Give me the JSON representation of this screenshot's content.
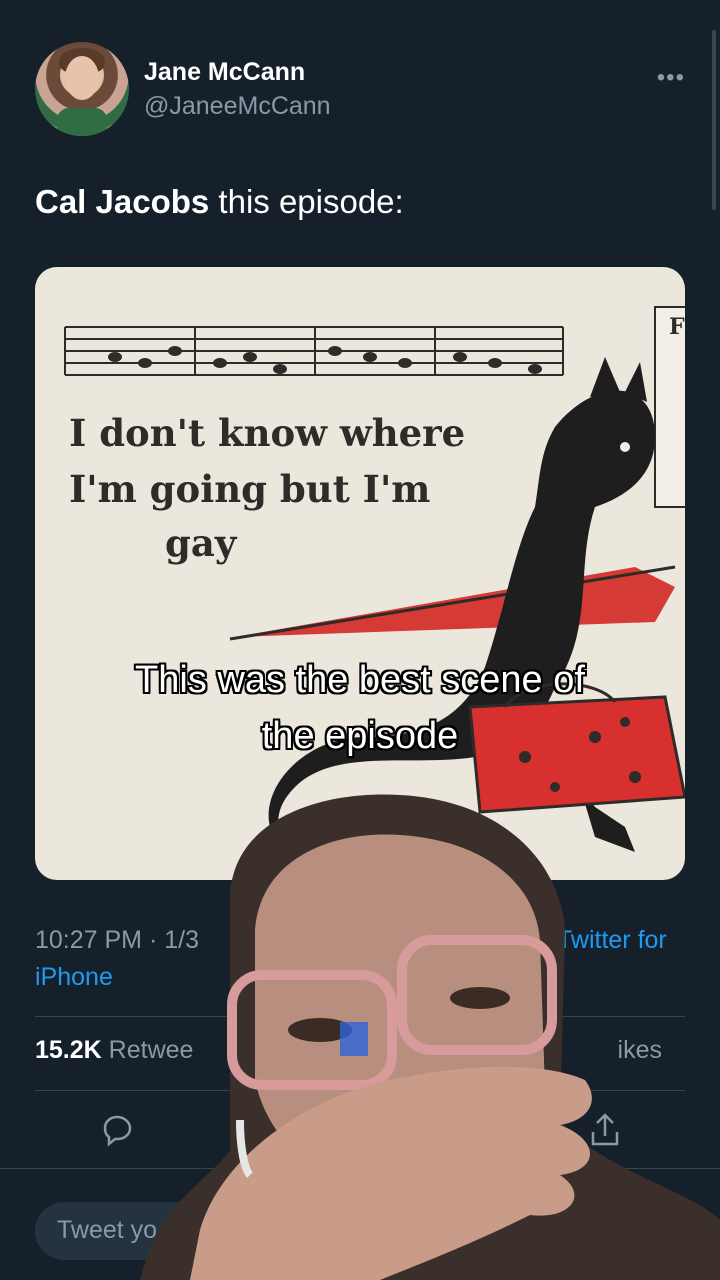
{
  "tweet": {
    "author_name": "Jane McCann",
    "author_handle": "@JaneeMcCann",
    "more_label": "•••",
    "text_bold": "Cal Jacobs",
    "text_rest": " this episode:",
    "meme_line1": "I don't know where",
    "meme_line2": "I'm going but I'm",
    "meme_line3": "gay",
    "meme_corner": "F",
    "time": "10:27 PM · 1/3",
    "source_tail": "Twitter for",
    "source_line2": "iPhone",
    "retweets_count": "15.2K",
    "retweets_label": "Retwee",
    "likes_label": "ikes"
  },
  "reply": {
    "placeholder": "Tweet yo"
  },
  "video": {
    "caption_line1": "This was the best scene of",
    "caption_line2": "the episode"
  },
  "colors": {
    "background": "#15202b",
    "accent": "#1d9bf0",
    "muted": "#8b98a5"
  }
}
